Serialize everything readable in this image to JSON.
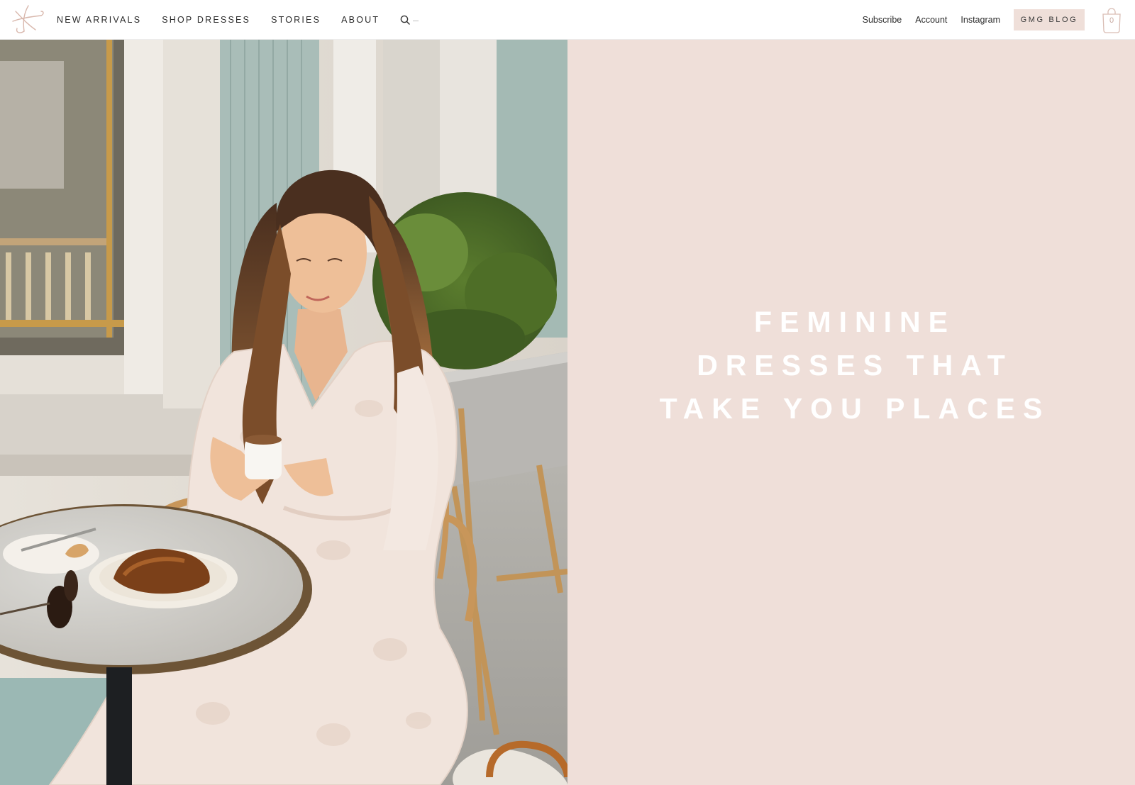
{
  "nav": {
    "logo_icon": "script-flourish-logo",
    "links": [
      "NEW ARRIVALS",
      "SHOP DRESSES",
      "STORIES",
      "ABOUT"
    ],
    "search_icon": "search-icon"
  },
  "utility": {
    "subscribe": "Subscribe",
    "account": "Account",
    "instagram": "Instagram",
    "blog_button": "GMG BLOG",
    "cart_icon": "shopping-bag-icon",
    "cart_count": "0"
  },
  "hero": {
    "headline_lines": [
      "FEMININE",
      "DRESSES THAT",
      "TAKE YOU PLACES"
    ],
    "photo_icon": "hero-photo"
  },
  "colors": {
    "panel_bg": "#efdfd9",
    "headline": "#ffffff",
    "text": "#2b2b2b",
    "accent": "#c8a9a0"
  }
}
